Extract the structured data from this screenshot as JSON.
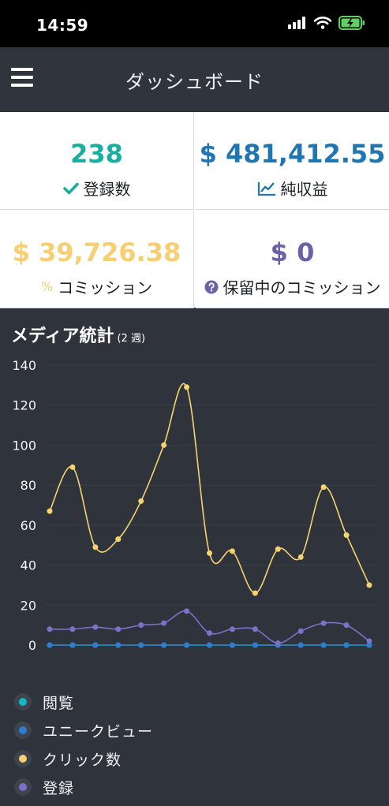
{
  "status_bar": {
    "time": "14:59"
  },
  "header": {
    "title": "ダッシュボード"
  },
  "stats": [
    {
      "value": "238",
      "label": "登録数",
      "color": "#1aae9f",
      "icon": "check-icon"
    },
    {
      "value": "$ 481,412.55",
      "label": "純収益",
      "color": "#2176b2",
      "icon": "line-chart-icon"
    },
    {
      "value": "$ 39,726.38",
      "label": "コミッション",
      "color": "#f7cf72",
      "icon": "percent-icon"
    },
    {
      "value": "$ 0",
      "label": "保留中のコミッション",
      "color": "#6c61a8",
      "icon": "question-circle-icon"
    }
  ],
  "chart_title": "メディア統計",
  "chart_subtitle": "(2 週)",
  "chart_data": {
    "type": "line",
    "y_ticks": [
      "140",
      "120",
      "100",
      "80",
      "60",
      "40",
      "20",
      "0"
    ],
    "ylim": [
      0,
      140
    ],
    "x_count": 15,
    "grid": true,
    "legend_position": "bottom",
    "series": [
      {
        "name": "閲覧",
        "color": "#14b8c4",
        "values": [
          0,
          0,
          0,
          0,
          0,
          0,
          0,
          0,
          0,
          0,
          0,
          0,
          0,
          0,
          0
        ]
      },
      {
        "name": "ユニークビュー",
        "color": "#2c7fd0",
        "values": [
          0,
          0,
          0,
          0,
          0,
          0,
          0,
          0,
          0,
          0,
          0,
          0,
          0,
          0,
          0
        ]
      },
      {
        "name": "クリック数",
        "color": "#f6d36f",
        "values": [
          67,
          89,
          49,
          53,
          72,
          100,
          129,
          46,
          47,
          26,
          48,
          44,
          79,
          55,
          30
        ]
      },
      {
        "name": "登録",
        "color": "#7e6fc8",
        "values": [
          8,
          8,
          9,
          8,
          10,
          11,
          17,
          6,
          8,
          8,
          1,
          7,
          11,
          10,
          2
        ]
      }
    ]
  }
}
